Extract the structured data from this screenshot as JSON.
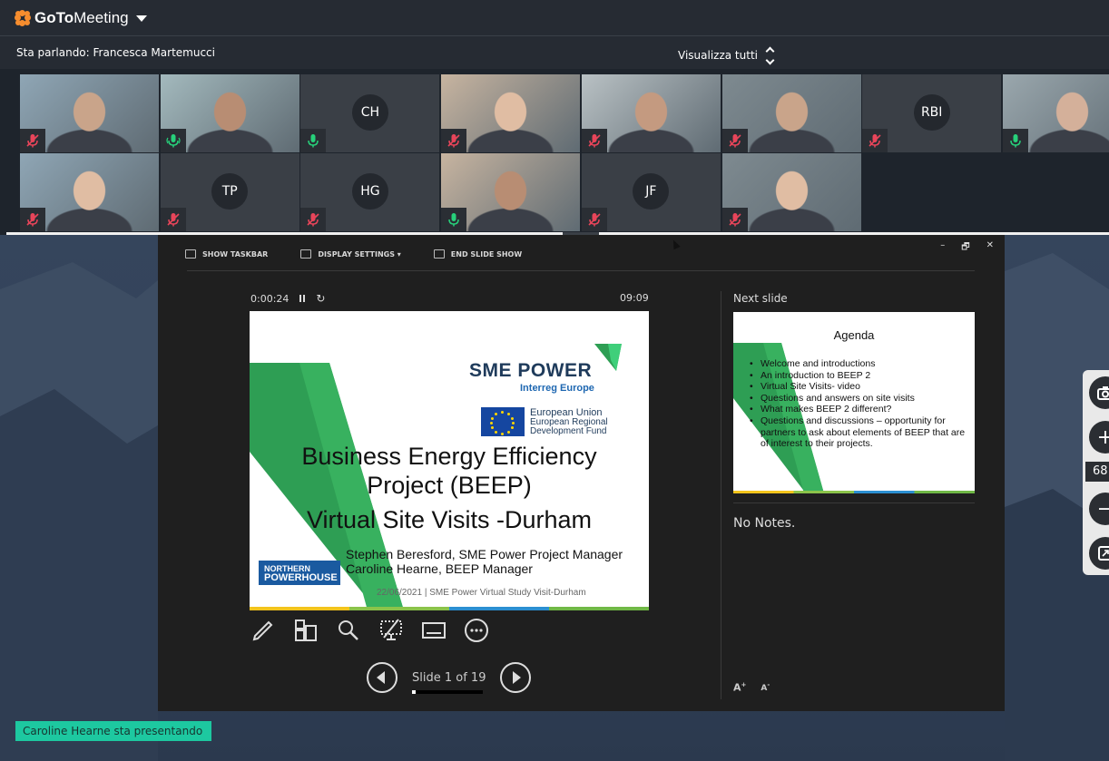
{
  "app": {
    "logo_bold": "GoTo",
    "logo_rest": "Meeting",
    "orange": "#f68d2e"
  },
  "speakerbar": {
    "speaking": "Sta parlando: Francesca Martemucci",
    "view_all": "Visualizza tutti"
  },
  "participants": [
    {
      "initials": "",
      "mic": "muted",
      "video": true
    },
    {
      "initials": "",
      "mic": "speaking",
      "video": true,
      "active": true
    },
    {
      "initials": "CH",
      "mic": "on",
      "video": false
    },
    {
      "initials": "",
      "mic": "muted",
      "video": true
    },
    {
      "initials": "",
      "mic": "muted",
      "video": true
    },
    {
      "initials": "",
      "mic": "muted",
      "video": true
    },
    {
      "initials": "RBI",
      "mic": "muted",
      "video": false
    },
    {
      "initials": "",
      "mic": "on",
      "video": true
    },
    {
      "initials": "",
      "mic": "muted",
      "video": true
    },
    {
      "initials": "TP",
      "mic": "muted",
      "video": false
    },
    {
      "initials": "HG",
      "mic": "muted",
      "video": false
    },
    {
      "initials": "",
      "mic": "on",
      "video": true
    },
    {
      "initials": "JF",
      "mic": "muted",
      "video": false
    },
    {
      "initials": "",
      "mic": "muted",
      "video": true
    }
  ],
  "presenter_view": {
    "toolbar": {
      "show_taskbar": "SHOW TASKBAR",
      "display_settings": "DISPLAY SETTINGS ▾",
      "end_show": "END SLIDE SHOW"
    },
    "window_controls": {
      "minimize": "–",
      "restore": "🗗",
      "close": "✕"
    },
    "elapsed": "0:00:24",
    "clock": "09:09",
    "slide_counter": "Slide 1 of 19",
    "progress_fraction": 0.05,
    "next_slide_label": "Next slide",
    "notes": "No Notes.",
    "font_up": "A",
    "font_down": "A"
  },
  "current_slide": {
    "sme_power": "SME POWER",
    "interreg": "Interreg Europe",
    "eu_line1": "European Union",
    "eu_line2": "European Regional",
    "eu_line3": "Development Fund",
    "title_line1": "Business Energy Efficiency",
    "title_line2": "Project (BEEP)",
    "title_line3": "Virtual Site Visits -Durham",
    "author1": "Stephen Beresford, SME Power Project Manager",
    "author2": "Caroline Hearne, BEEP Manager",
    "footer": "22/06/2021   |  SME Power Virtual Study Visit-Durham",
    "np_line1": "NORTHERN",
    "np_line2": "POWERHOUSE"
  },
  "next_slide": {
    "title": "Agenda",
    "items": [
      "Welcome and introductions",
      "An introduction to BEEP 2",
      "Virtual Site Visits- video",
      "Questions and answers on site visits",
      "What makes BEEP 2 different?",
      "Questions and discussions – opportunity for partners to ask about elements of BEEP that are of interest to their projects."
    ]
  },
  "zoom": {
    "level": "68",
    "plus": "+",
    "minus": "−"
  },
  "presenting_banner": "Caroline Hearne sta presentando",
  "colors": {
    "accent_green": "#1dc8a0",
    "slide_green": "#2e9e54"
  }
}
